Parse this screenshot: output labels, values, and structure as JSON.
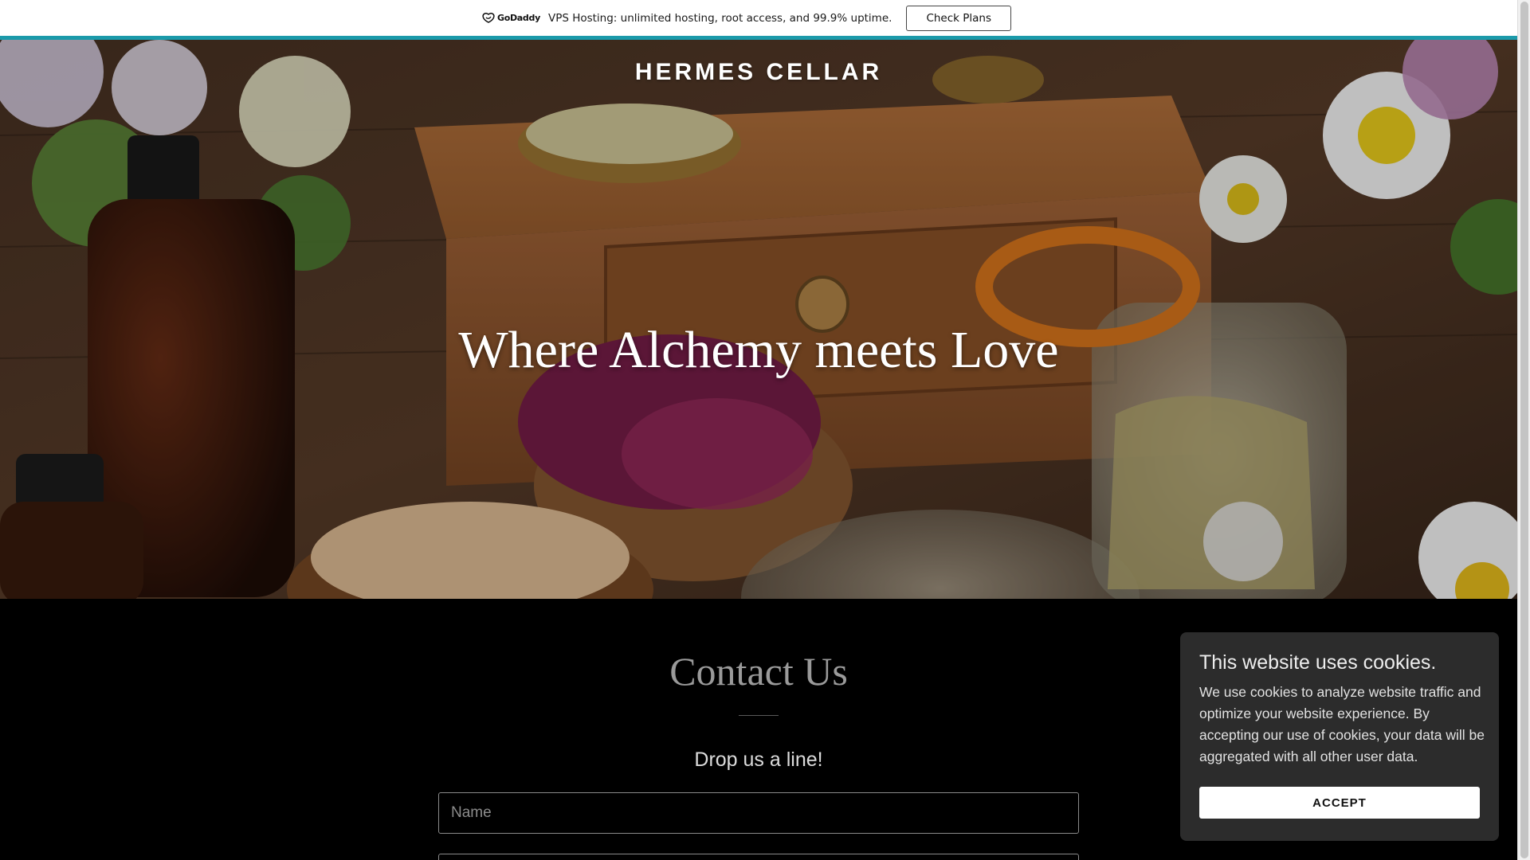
{
  "promo": {
    "logo_text": "GoDaddy",
    "message": "VPS Hosting: unlimited hosting, root access, and 99.9% uptime.",
    "button_label": "Check Plans"
  },
  "hero": {
    "brand": "HERMES CELLAR",
    "tagline": "Where Alchemy meets Love"
  },
  "contact": {
    "title": "Contact Us",
    "subtitle": "Drop us a line!",
    "name_placeholder": "Name",
    "email_placeholder": ""
  },
  "cookie": {
    "title": "This website uses cookies.",
    "text": "We use cookies to analyze website traffic and optimize your website experience. By accepting our use of cookies, your data will be aggregated with all other user data.",
    "accept_label": "ACCEPT"
  },
  "colors": {
    "promo_accent": "#1b9aaa",
    "page_bg": "#000000",
    "cookie_bg": "#2c2c2c"
  }
}
